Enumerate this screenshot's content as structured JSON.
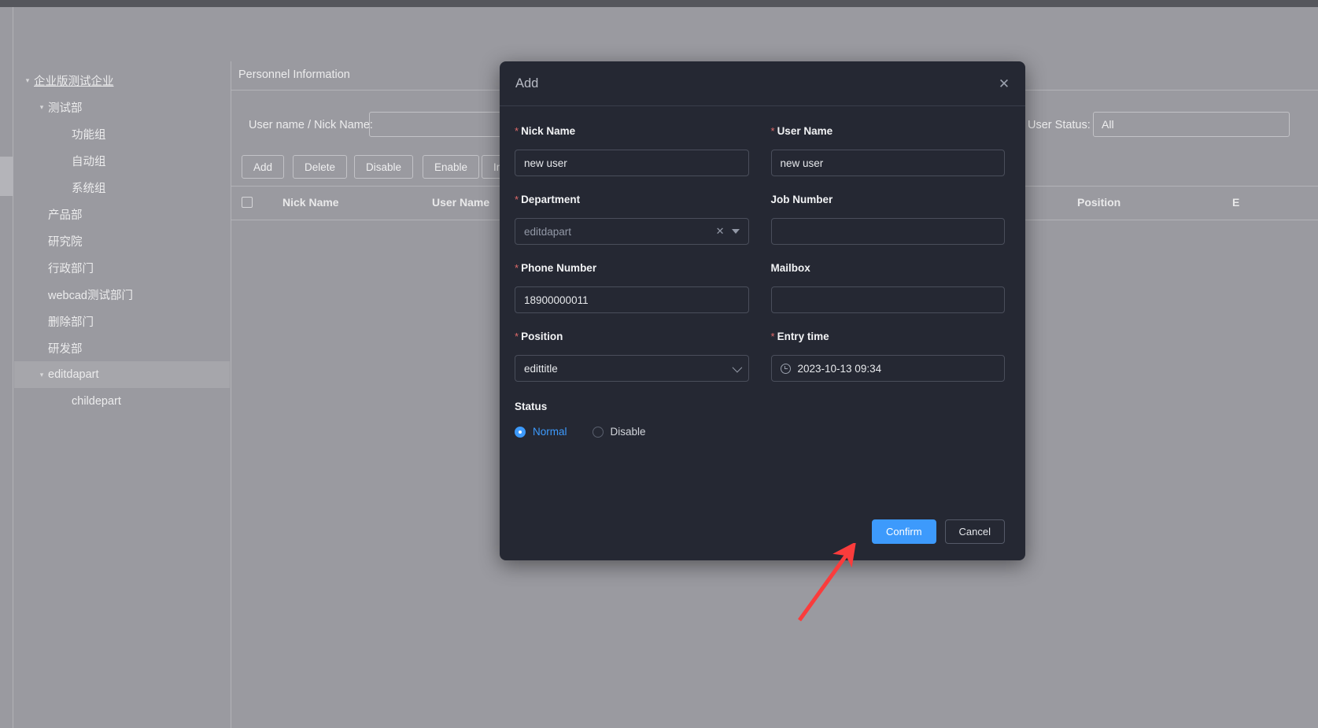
{
  "sidebar": {
    "items": [
      {
        "label": "企业版测试企业",
        "level": 0,
        "caret": "▾",
        "root": true,
        "selected": false
      },
      {
        "label": "测试部",
        "level": 1,
        "caret": "▾",
        "root": false,
        "selected": false
      },
      {
        "label": "功能组",
        "level": 2,
        "caret": "",
        "root": false,
        "selected": false
      },
      {
        "label": "自动组",
        "level": 2,
        "caret": "",
        "root": false,
        "selected": false
      },
      {
        "label": "系统组",
        "level": 2,
        "caret": "",
        "root": false,
        "selected": false
      },
      {
        "label": "产品部",
        "level": 1,
        "caret": "",
        "root": false,
        "selected": false
      },
      {
        "label": "研究院",
        "level": 1,
        "caret": "",
        "root": false,
        "selected": false
      },
      {
        "label": "行政部门",
        "level": 1,
        "caret": "",
        "root": false,
        "selected": false
      },
      {
        "label": "webcad测试部门",
        "level": 1,
        "caret": "",
        "root": false,
        "selected": false
      },
      {
        "label": "删除部门",
        "level": 1,
        "caret": "",
        "root": false,
        "selected": false
      },
      {
        "label": "研发部",
        "level": 1,
        "caret": "",
        "root": false,
        "selected": false
      },
      {
        "label": "editdapart",
        "level": 1,
        "caret": "▾",
        "root": false,
        "selected": true
      },
      {
        "label": "childepart",
        "level": 2,
        "caret": "",
        "root": false,
        "selected": false
      }
    ]
  },
  "main": {
    "panel_title": "Personnel Information",
    "filters": [
      {
        "label": "User name / Nick Name:",
        "value": "",
        "placeholder": ""
      },
      {
        "label": "User Status:",
        "value": "All",
        "placeholder": ""
      }
    ],
    "toolbar_buttons": [
      "Add",
      "Delete",
      "Disable",
      "Enable",
      "Import"
    ],
    "table_headers": [
      "Nick Name",
      "User Name",
      "Position",
      "E"
    ]
  },
  "modal": {
    "title": "Add",
    "close_icon": "✕",
    "fields": [
      {
        "label": "Nick Name",
        "required": true,
        "value": "new user",
        "type": "text"
      },
      {
        "label": "User Name",
        "required": true,
        "value": "new user",
        "type": "text"
      },
      {
        "label": "Department",
        "required": true,
        "value": "editdapart",
        "type": "select-clearable"
      },
      {
        "label": "Job Number",
        "required": false,
        "value": "",
        "type": "text"
      },
      {
        "label": "Phone Number",
        "required": true,
        "value": "18900000011",
        "type": "text"
      },
      {
        "label": "Mailbox",
        "required": false,
        "value": "",
        "type": "text"
      },
      {
        "label": "Position",
        "required": true,
        "value": "edittitle",
        "type": "select"
      },
      {
        "label": "Entry time",
        "required": true,
        "value": "2023-10-13 09:34",
        "type": "datetime"
      }
    ],
    "status": {
      "label": "Status",
      "options": [
        {
          "label": "Normal",
          "checked": true
        },
        {
          "label": "Disable",
          "checked": false
        }
      ]
    },
    "footer": {
      "confirm_label": "Confirm",
      "cancel_label": "Cancel"
    }
  },
  "annotation": {
    "arrow_color": "#fa3c3c"
  }
}
